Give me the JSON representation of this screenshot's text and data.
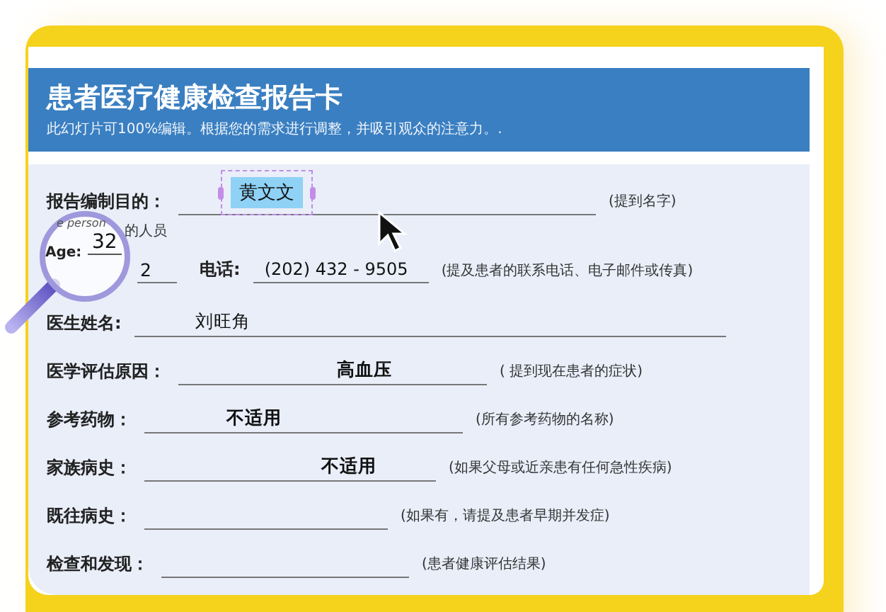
{
  "header": {
    "title": "患者医疗健康检查报告卡",
    "subtitle": "此幻灯片可100%编辑。根据您的需求进行调整，并吸引观众的注意力。."
  },
  "form": {
    "rows": [
      {
        "kind": "selected",
        "label": "报告编制目的：",
        "value": "黄文文",
        "hint": "(提到名字)"
      },
      {
        "kind": "note",
        "text": "的人员"
      },
      {
        "kind": "pair",
        "value": "2",
        "label": "电话:",
        "value2": "(202) 432 - 9505",
        "hint": "(提及患者的联系电话、电子邮件或传真)"
      },
      {
        "kind": "field",
        "label": "医生姓名:",
        "value": "刘旺角",
        "bold": false
      },
      {
        "kind": "field",
        "label": "医学评估原因：",
        "value": "高血压",
        "bold": true,
        "hint": "( 提到现在患者的症状)"
      },
      {
        "kind": "field",
        "label": "参考药物：",
        "value": "不适用",
        "bold": true,
        "hint": "(所有参考药物的名称)"
      },
      {
        "kind": "field",
        "label": "家族病史：",
        "value": "不适用",
        "bold": true,
        "hint": "(如果父母或近亲患有任何急性疾病)"
      },
      {
        "kind": "field",
        "label": "既往病史：",
        "hint": "(如果有，请提及患者早期并发症)"
      },
      {
        "kind": "field",
        "label": "检查和发现：",
        "hint": "(患者健康评估结果)"
      }
    ]
  },
  "magnifier": {
    "caption": "e person",
    "label": "Age:",
    "value": "32"
  }
}
